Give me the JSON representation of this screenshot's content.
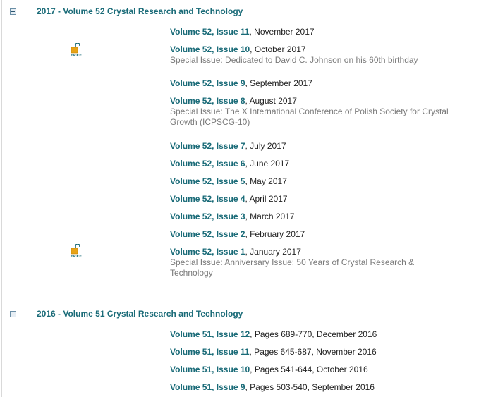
{
  "volumes": [
    {
      "title": "2017 - Volume 52 Crystal Research and Technology",
      "issues": [
        {
          "link": "Volume 52, Issue 11",
          "rest": ", November 2017",
          "special": ""
        },
        {
          "link": "Volume 52, Issue 10",
          "rest": ", October 2017",
          "special": "Special Issue: Dedicated to David C. Johnson on his 60th birthday",
          "free": true
        },
        {
          "link": "Volume 52, Issue 9",
          "rest": ", September 2017",
          "special": ""
        },
        {
          "link": "Volume 52, Issue 8",
          "rest": ", August 2017",
          "special": "Special Issue: The X International Conference of Polish Society for Crystal Growth (ICPSCG-10)"
        },
        {
          "link": "Volume 52, Issue 7",
          "rest": ", July 2017",
          "special": ""
        },
        {
          "link": "Volume 52, Issue 6",
          "rest": ", June 2017",
          "special": ""
        },
        {
          "link": "Volume 52, Issue 5",
          "rest": ", May 2017",
          "special": ""
        },
        {
          "link": "Volume 52, Issue 4",
          "rest": ", April 2017",
          "special": ""
        },
        {
          "link": "Volume 52, Issue 3",
          "rest": ", March 2017",
          "special": ""
        },
        {
          "link": "Volume 52, Issue 2",
          "rest": ", February 2017",
          "special": ""
        },
        {
          "link": "Volume 52, Issue 1",
          "rest": ", January 2017",
          "special": "Special Issue: Anniversary Issue: 50 Years of Crystal Research & Technology",
          "free": true
        }
      ]
    },
    {
      "title": "2016 - Volume 51 Crystal Research and Technology",
      "issues": [
        {
          "link": "Volume 51, Issue 12",
          "rest": ", Pages 689-770, December 2016",
          "special": ""
        },
        {
          "link": "Volume 51, Issue 11",
          "rest": ", Pages 645-687, November 2016",
          "special": ""
        },
        {
          "link": "Volume 51, Issue 10",
          "rest": ", Pages 541-644, October 2016",
          "special": ""
        },
        {
          "link": "Volume 51, Issue 9",
          "rest": ", Pages 503-540, September 2016",
          "special": ""
        }
      ]
    }
  ],
  "free_badge": {
    "text": "FREE",
    "icon": "open-padlock-icon",
    "lock_color": "#e8a317",
    "shackle_color": "#1a6b78"
  },
  "colors": {
    "link": "#1a6b78",
    "special": "#7a7a7a",
    "text": "#222222"
  }
}
